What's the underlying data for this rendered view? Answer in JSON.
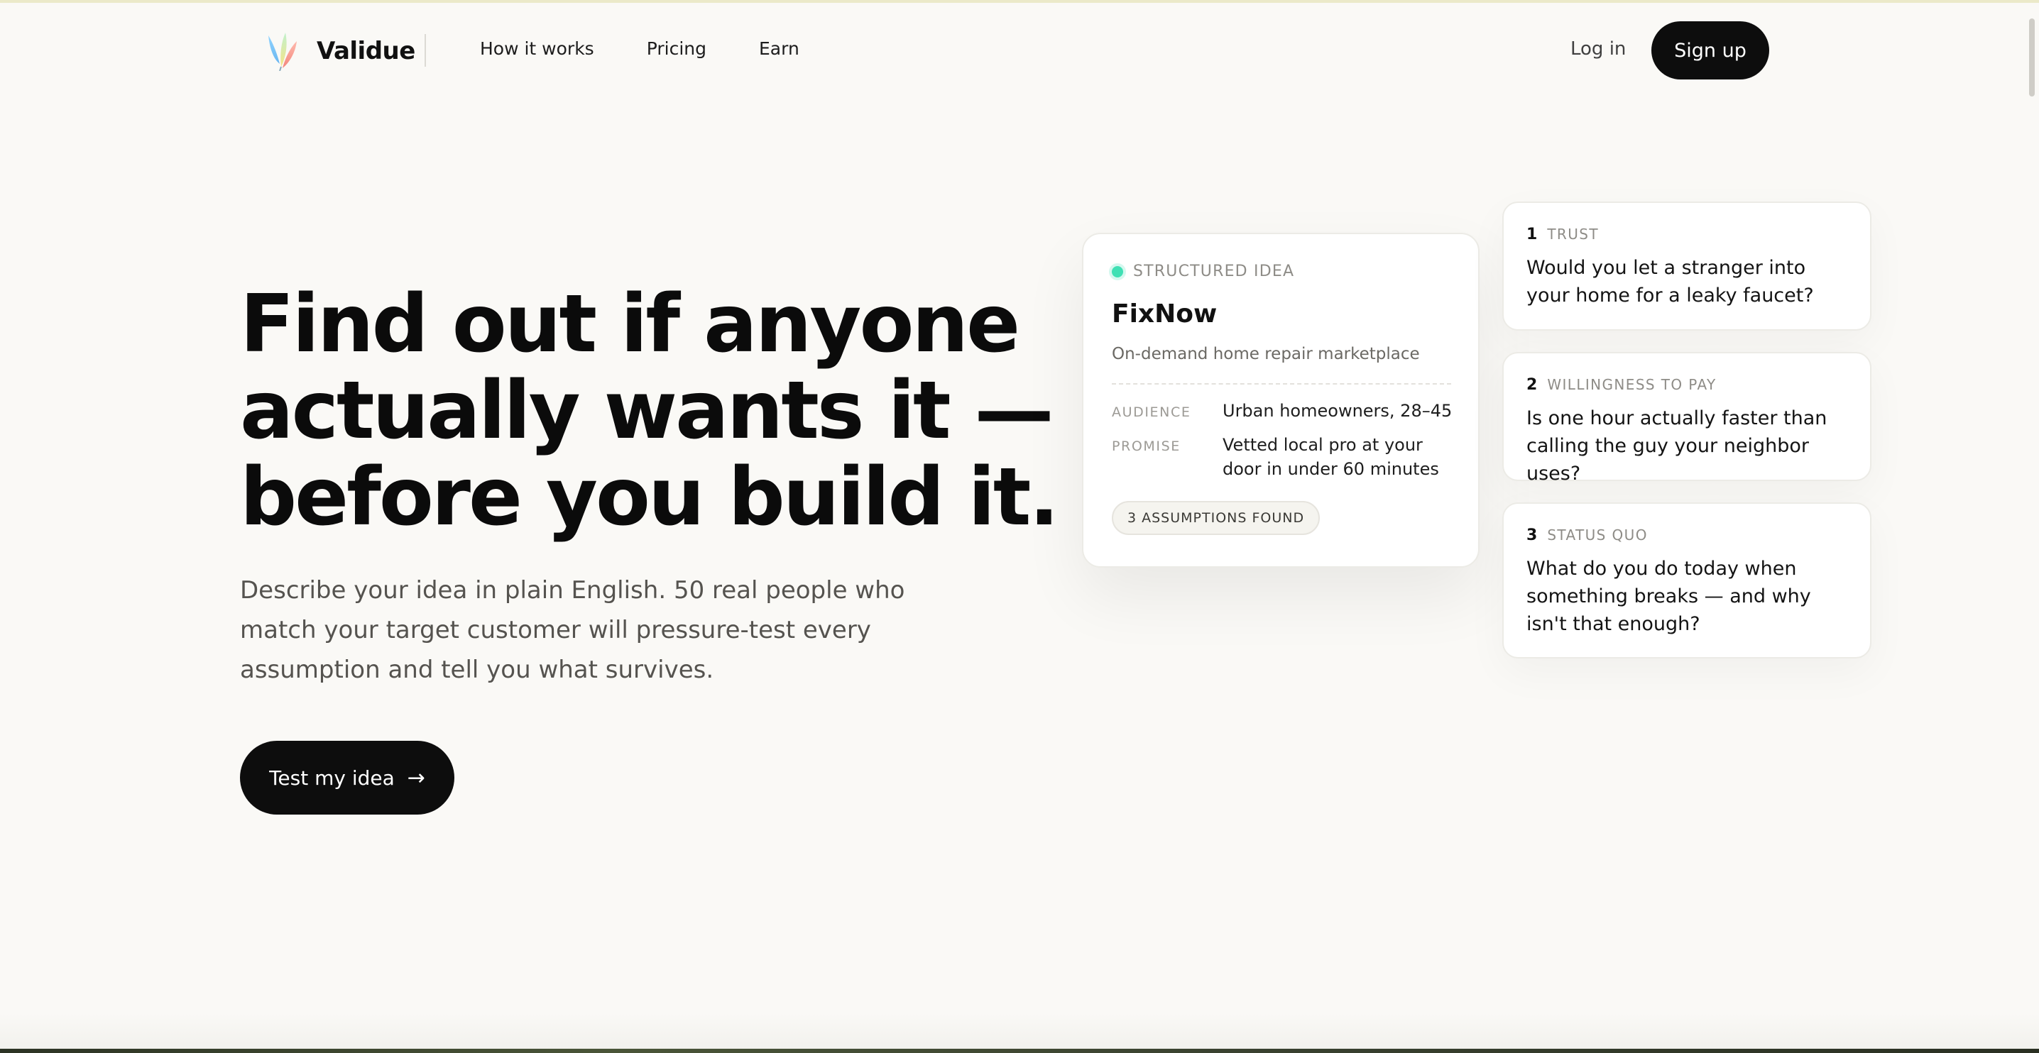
{
  "brand": {
    "name": "Validue",
    "logo_icon": "validue-flame-logo-icon"
  },
  "nav": {
    "links": [
      "How it works",
      "Pricing",
      "Earn"
    ],
    "login_label": "Log in",
    "signup_label": "Sign up"
  },
  "hero": {
    "headline_lines": [
      "Find out if anyone",
      "actually wants it —",
      "before you build it."
    ],
    "subhead": "Describe your idea in plain English. 50 real people who match your target customer will pressure-test every assumption and tell you what survives.",
    "cta_label": "Test my idea",
    "cta_icon": "arrow-right-icon",
    "cta_arrow": "→"
  },
  "idea_card": {
    "label": "STRUCTURED IDEA",
    "title": "FixNow",
    "description": "On-demand home repair marketplace",
    "fields": [
      {
        "label": "AUDIENCE",
        "value": "Urban homeowners, 28–45"
      },
      {
        "label": "PROMISE",
        "value": "Vetted local pro at your door in under 60 minutes"
      }
    ],
    "badge": "3 ASSUMPTIONS FOUND",
    "status_color": "#3fe0b4"
  },
  "questions": [
    {
      "number": "1",
      "category": "TRUST",
      "text": "Would you let a stranger into your home for a leaky faucet?"
    },
    {
      "number": "2",
      "category": "WILLINGNESS TO PAY",
      "text": "Is one hour actually faster than calling the guy your neighbor uses?"
    },
    {
      "number": "3",
      "category": "STATUS QUO",
      "text": "What do you do today when something breaks — and why isn't that enough?"
    }
  ],
  "colors": {
    "background": "#faf9f6",
    "primary_button": "#0d0d0d",
    "accent_dot": "#3fe0b4"
  }
}
